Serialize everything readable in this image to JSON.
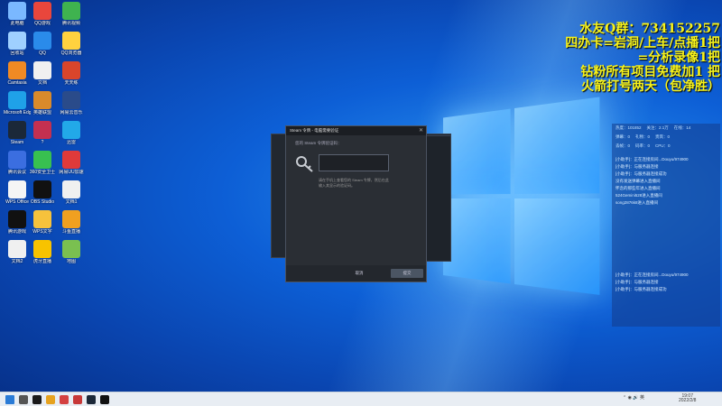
{
  "desktop_icons": [
    {
      "label": "此电脑",
      "color": "#7ab8ff"
    },
    {
      "label": "QQ游戏",
      "color": "#e9463c"
    },
    {
      "label": "腾讯视频",
      "color": "#3fb34f"
    },
    {
      "label": "回收站",
      "color": "#9fd0ff"
    },
    {
      "label": "QQ",
      "color": "#2a8bea"
    },
    {
      "label": "QQ浏览器",
      "color": "#ffd23f"
    },
    {
      "label": "Camtasia",
      "color": "#f08a24"
    },
    {
      "label": "文档",
      "color": "#f0f0f0"
    },
    {
      "label": "天天练",
      "color": "#d9452b"
    },
    {
      "label": "Microsoft Edge",
      "color": "#1fa1e8"
    },
    {
      "label": "英雄联盟",
      "color": "#d98a2b"
    },
    {
      "label": "网易云音乐",
      "color": "#2a4b8a"
    },
    {
      "label": "Steam",
      "color": "#1b2838"
    },
    {
      "label": "?",
      "color": "#c43050"
    },
    {
      "label": "迅雷",
      "color": "#22a9e8"
    },
    {
      "label": "腾讯会议",
      "color": "#3b6ee0"
    },
    {
      "label": "360安全卫士",
      "color": "#38c050"
    },
    {
      "label": "网易UU加速",
      "color": "#e03a3a"
    },
    {
      "label": "WPS Office",
      "color": "#f5f5f5"
    },
    {
      "label": "OBS Studio",
      "color": "#111111"
    },
    {
      "label": "文档1",
      "color": "#f0f0f0"
    },
    {
      "label": "腾讯游戏",
      "color": "#111111"
    },
    {
      "label": "WPS文字",
      "color": "#f6c23c"
    },
    {
      "label": "斗鱼直播",
      "color": "#f0a020"
    },
    {
      "label": "文档2",
      "color": "#f0f0f0"
    },
    {
      "label": "虎牙直播",
      "color": "#f8c300"
    },
    {
      "label": "地图",
      "color": "#7ac050"
    }
  ],
  "overlay": {
    "line1": "水友Q群：734152257",
    "line2": "四办卡=岩洞/上车/点播1把",
    "line3": "=分析录像1把",
    "line4": "钻粉所有项目免费加1 把",
    "line5": "火箭打号两天（包净胜）"
  },
  "stats": {
    "row1": [
      "热度：101852",
      "关注：2.1万",
      "在线：14"
    ],
    "row2": [
      "弹幕：0",
      "礼物：0",
      "贵宾：0"
    ],
    "row3": [
      "丢帧：0",
      "码率：0",
      "CPU：0"
    ],
    "log": [
      "[小助手]：正在连接房间...Douyu/974900",
      "[小助手]：与服务器连接",
      "[小助手]：与服务器连接成功",
      "没有发送弹幕进入直播间",
      "怀念的那些年进入直播间",
      "524Gemini528进入直播间",
      "song2876k8进入直播间"
    ],
    "log2": [
      "[小助手]：正在连接房间...Douyu/974900",
      "[小助手]：与服务器连接",
      "[小助手]：与服务器连接成功"
    ]
  },
  "steam_dialog": {
    "title": "Steam 令牌 - 电脑需要验证",
    "prompt": "您的 Steam 令牌验证码：",
    "description": "请在手机上查看您的 Steam 令牌，然后在此输入其显示的验证码。",
    "cancel_label": "取消",
    "submit_label": "提交"
  },
  "taskbar": {
    "time": "19:07",
    "date": "2022/2/8",
    "search_placeholder": "",
    "icons": [
      {
        "name": "start-icon",
        "color": "#2a7bd6"
      },
      {
        "name": "search-icon",
        "color": "#555555"
      },
      {
        "name": "qq-icon",
        "color": "#1a1a1a"
      },
      {
        "name": "edge-icon",
        "color": "#e6a21f"
      },
      {
        "name": "chrome-icon",
        "color": "#d44141"
      },
      {
        "name": "video-icon",
        "color": "#c73838"
      },
      {
        "name": "steam-icon",
        "color": "#1b2838"
      },
      {
        "name": "obs-icon",
        "color": "#111111"
      }
    ]
  }
}
